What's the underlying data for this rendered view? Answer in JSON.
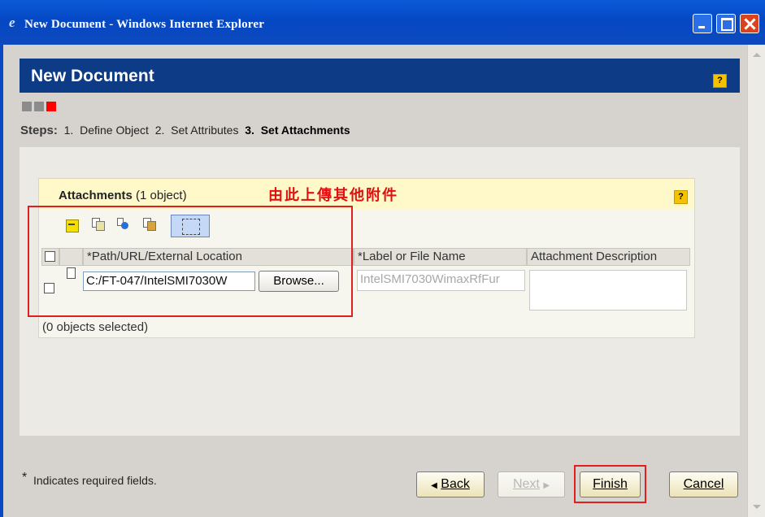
{
  "window": {
    "title": "New Document - Windows Internet Explorer",
    "controls": [
      "minimize",
      "maximize",
      "close"
    ]
  },
  "header": {
    "title": "New Document",
    "help_label": "?"
  },
  "progress": {
    "boxes": [
      {
        "state": "done",
        "color": "#8c8c8c"
      },
      {
        "state": "done",
        "color": "#8c8c8c"
      },
      {
        "state": "current",
        "color": "#ff0000"
      }
    ]
  },
  "steps": {
    "label": "Steps:",
    "items": [
      {
        "num": "1.",
        "label": "Define Object"
      },
      {
        "num": "2.",
        "label": "Set Attributes"
      },
      {
        "num": "3.",
        "label": "Set Attachments",
        "current": true
      }
    ]
  },
  "attachments": {
    "title": "Attachments",
    "count": "(1 object)",
    "note": "由此上傳其他附件",
    "help_label": "?",
    "toolbar_icons": [
      "select-all-icon",
      "add-file-icon",
      "add-url-icon",
      "add-external-icon",
      "drag-drop-icon"
    ],
    "columns": [
      "*Path/URL/External Location",
      "*Label or File Name",
      "Attachment Description"
    ],
    "rows": [
      {
        "path": "C:/FT-047/IntelSMI7030W",
        "browse_label": "Browse...",
        "file_name": "IntelSMI7030WimaxRfFur",
        "description": ""
      }
    ],
    "status": "(0 objects selected)"
  },
  "footer": {
    "required_star": "*",
    "required_text": "Indicates required fields.",
    "buttons": {
      "back": "Back",
      "next": "Next",
      "finish": "Finish",
      "cancel": "Cancel"
    }
  },
  "colors": {
    "titlebar": "#0548c4",
    "header": "#0d3b85",
    "highlight": "#e02020",
    "note": "#e01010"
  }
}
